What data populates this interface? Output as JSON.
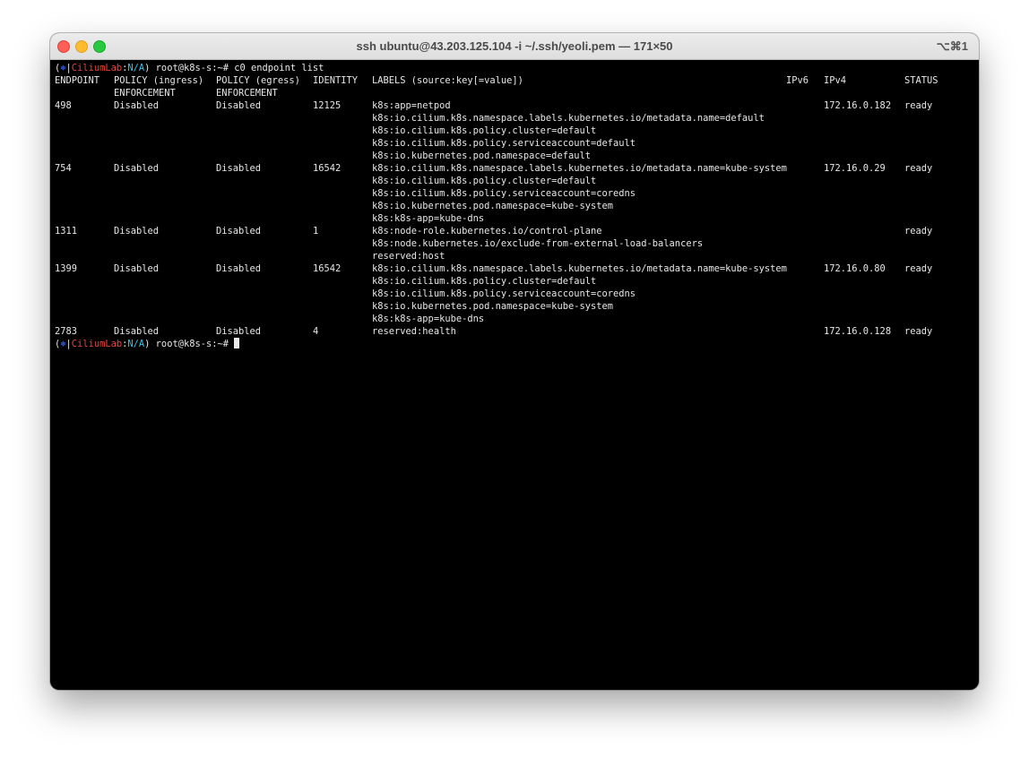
{
  "window": {
    "title": "ssh ubuntu@43.203.125.104 -i ~/.ssh/yeoli.pem — 171×50",
    "shortcut": "⌥⌘1"
  },
  "prompt": {
    "open": "(",
    "symbol": "⎈",
    "sep": "|",
    "cluster": "CiliumLab",
    "colon": ":",
    "namespace": "N/A",
    "close": ")",
    "user_host": " root@k8s-s:~# ",
    "command": "c0 endpoint list"
  },
  "headers": {
    "endpoint": "ENDPOINT",
    "ingress_1": "POLICY (ingress)",
    "ingress_2": "ENFORCEMENT",
    "egress_1": "POLICY (egress)",
    "egress_2": "ENFORCEMENT",
    "identity": "IDENTITY",
    "labels": "LABELS (source:key[=value])",
    "ipv6": "IPv6",
    "ipv4": "IPv4",
    "status": "STATUS"
  },
  "endpoints": [
    {
      "id": "498",
      "ingress": "Disabled",
      "egress": "Disabled",
      "identity": "12125",
      "labels": [
        "k8s:app=netpod",
        "k8s:io.cilium.k8s.namespace.labels.kubernetes.io/metadata.name=default",
        "k8s:io.cilium.k8s.policy.cluster=default",
        "k8s:io.cilium.k8s.policy.serviceaccount=default",
        "k8s:io.kubernetes.pod.namespace=default"
      ],
      "ipv6": "",
      "ipv4": "172.16.0.182",
      "status": "ready"
    },
    {
      "id": "754",
      "ingress": "Disabled",
      "egress": "Disabled",
      "identity": "16542",
      "labels": [
        "k8s:io.cilium.k8s.namespace.labels.kubernetes.io/metadata.name=kube-system",
        "k8s:io.cilium.k8s.policy.cluster=default",
        "k8s:io.cilium.k8s.policy.serviceaccount=coredns",
        "k8s:io.kubernetes.pod.namespace=kube-system",
        "k8s:k8s-app=kube-dns"
      ],
      "ipv6": "",
      "ipv4": "172.16.0.29",
      "status": "ready"
    },
    {
      "id": "1311",
      "ingress": "Disabled",
      "egress": "Disabled",
      "identity": "1",
      "labels": [
        "k8s:node-role.kubernetes.io/control-plane",
        "k8s:node.kubernetes.io/exclude-from-external-load-balancers",
        "reserved:host"
      ],
      "ipv6": "",
      "ipv4": "",
      "status": "ready"
    },
    {
      "id": "1399",
      "ingress": "Disabled",
      "egress": "Disabled",
      "identity": "16542",
      "labels": [
        "k8s:io.cilium.k8s.namespace.labels.kubernetes.io/metadata.name=kube-system",
        "k8s:io.cilium.k8s.policy.cluster=default",
        "k8s:io.cilium.k8s.policy.serviceaccount=coredns",
        "k8s:io.kubernetes.pod.namespace=kube-system",
        "k8s:k8s-app=kube-dns"
      ],
      "ipv6": "",
      "ipv4": "172.16.0.80",
      "status": "ready"
    },
    {
      "id": "2783",
      "ingress": "Disabled",
      "egress": "Disabled",
      "identity": "4",
      "labels": [
        "reserved:health"
      ],
      "ipv6": "",
      "ipv4": "172.16.0.128",
      "status": "ready"
    }
  ]
}
